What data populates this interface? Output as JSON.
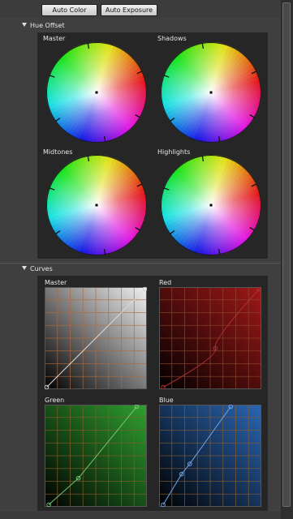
{
  "toolbar": {
    "auto_color_label": "Auto Color",
    "auto_exposure_label": "Auto Exposure"
  },
  "hue_offset": {
    "title": "Hue Offset",
    "wheels": [
      {
        "label": "Master"
      },
      {
        "label": "Shadows"
      },
      {
        "label": "Midtones"
      },
      {
        "label": "Highlights"
      }
    ]
  },
  "curves": {
    "title": "Curves",
    "graphs": [
      {
        "label": "Master",
        "color": "#ffffff"
      },
      {
        "label": "Red",
        "color": "#c0392b"
      },
      {
        "label": "Green",
        "color": "#3fae3f"
      },
      {
        "label": "Blue",
        "color": "#3a78c8"
      }
    ]
  },
  "icons": {
    "collapse": "triangle-down-icon"
  }
}
